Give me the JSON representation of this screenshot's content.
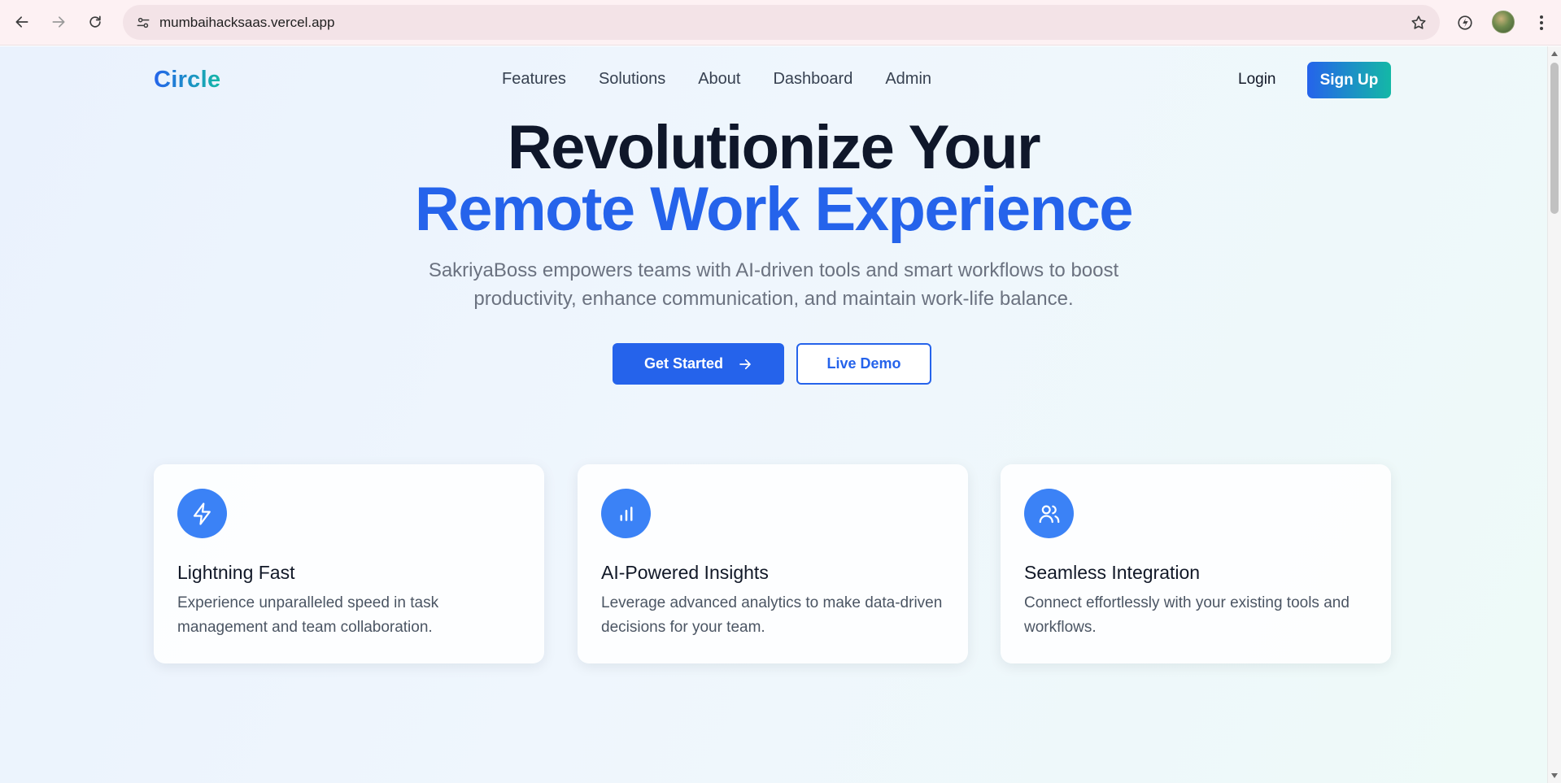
{
  "browser": {
    "url": "mumbaihacksaas.vercel.app",
    "back_icon": "arrow-left-icon",
    "forward_icon": "arrow-right-icon",
    "reload_icon": "reload-icon",
    "site_info_icon": "tune-icon",
    "bookmark_icon": "star-icon",
    "extension_icon": "performance-icon",
    "menu_icon": "kebab-menu-icon"
  },
  "header": {
    "logo": "Circle",
    "nav": [
      "Features",
      "Solutions",
      "About",
      "Dashboard",
      "Admin"
    ],
    "login_label": "Login",
    "signup_label": "Sign Up"
  },
  "hero": {
    "title_line1": "Revolutionize Your",
    "title_line2": "Remote Work Experience",
    "subtitle_line1": "SakriyaBoss empowers teams with AI-driven tools and smart workflows to boost",
    "subtitle_line2": "productivity, enhance communication, and maintain work-life balance.",
    "primary_cta": "Get Started",
    "secondary_cta": "Live Demo"
  },
  "features": [
    {
      "icon": "lightning-icon",
      "title": "Lightning Fast",
      "description": "Experience unparalleled speed in task management and team collaboration."
    },
    {
      "icon": "bar-chart-icon",
      "title": "AI-Powered Insights",
      "description": "Leverage advanced analytics to make data-driven decisions for your team."
    },
    {
      "icon": "users-icon",
      "title": "Seamless Integration",
      "description": "Connect effortlessly with your existing tools and workflows."
    }
  ],
  "colors": {
    "primary": "#2563eb",
    "accent_teal": "#14b8a6",
    "heading": "#0f172a",
    "muted_text": "#6b7280"
  }
}
